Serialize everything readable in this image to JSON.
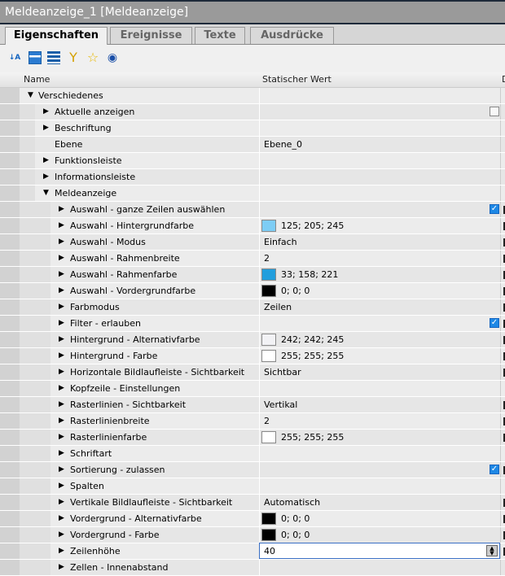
{
  "title": "Meldeanzeige_1 [Meldeanzeige]",
  "tabs": [
    "Eigenschaften",
    "Ereignisse",
    "Texte",
    "Ausdrücke"
  ],
  "header": {
    "name": "Name",
    "value": "Statischer Wert",
    "extra": "D"
  },
  "rows": [
    {
      "label": "Verschiedenes",
      "level": 0,
      "arrow": "down"
    },
    {
      "label": "Aktuelle anzeigen",
      "level": 1,
      "arrow": "right",
      "checkbox": false
    },
    {
      "label": "Beschriftung",
      "level": 1,
      "arrow": "right"
    },
    {
      "label": "Ebene",
      "level": 1,
      "arrow": "none",
      "value": "Ebene_0"
    },
    {
      "label": "Funktionsleiste",
      "level": 1,
      "arrow": "right"
    },
    {
      "label": "Informationsleiste",
      "level": 1,
      "arrow": "right"
    },
    {
      "label": "Meldeanzeige",
      "level": 1,
      "arrow": "down"
    },
    {
      "label": "Auswahl - ganze Zeilen auswählen",
      "level": 2,
      "arrow": "right",
      "checkbox": true,
      "mark": true
    },
    {
      "label": "Auswahl - Hintergrundfarbe",
      "level": 2,
      "arrow": "right",
      "color": "#7dcdf5",
      "value": "125; 205; 245",
      "mark": true
    },
    {
      "label": "Auswahl - Modus",
      "level": 2,
      "arrow": "right",
      "value": "Einfach",
      "mark": true
    },
    {
      "label": "Auswahl - Rahmenbreite",
      "level": 2,
      "arrow": "right",
      "value": "2",
      "mark": true
    },
    {
      "label": "Auswahl - Rahmenfarbe",
      "level": 2,
      "arrow": "right",
      "color": "#219edd",
      "value": "33; 158; 221",
      "mark": true
    },
    {
      "label": "Auswahl - Vordergrundfarbe",
      "level": 2,
      "arrow": "right",
      "color": "#000000",
      "value": "0; 0; 0",
      "mark": true
    },
    {
      "label": "Farbmodus",
      "level": 2,
      "arrow": "right",
      "value": "Zeilen",
      "mark": true
    },
    {
      "label": "Filter - erlauben",
      "level": 2,
      "arrow": "right",
      "checkbox": true,
      "mark": true
    },
    {
      "label": "Hintergrund - Alternativfarbe",
      "level": 2,
      "arrow": "right",
      "color": "#f2f2f5",
      "value": "242; 242; 245",
      "mark": true
    },
    {
      "label": "Hintergrund - Farbe",
      "level": 2,
      "arrow": "right",
      "color": "#ffffff",
      "value": "255; 255; 255",
      "mark": true
    },
    {
      "label": "Horizontale Bildlaufleiste - Sichtbarkeit",
      "level": 2,
      "arrow": "right",
      "value": "Sichtbar",
      "mark": true
    },
    {
      "label": "Kopfzeile - Einstellungen",
      "level": 2,
      "arrow": "right"
    },
    {
      "label": "Rasterlinien - Sichtbarkeit",
      "level": 2,
      "arrow": "right",
      "value": "Vertikal",
      "mark": true
    },
    {
      "label": "Rasterlinienbreite",
      "level": 2,
      "arrow": "right",
      "value": "2",
      "mark": true
    },
    {
      "label": "Rasterlinienfarbe",
      "level": 2,
      "arrow": "right",
      "color": "#ffffff",
      "value": "255; 255; 255",
      "mark": true
    },
    {
      "label": "Schriftart",
      "level": 2,
      "arrow": "right"
    },
    {
      "label": "Sortierung - zulassen",
      "level": 2,
      "arrow": "right",
      "checkbox": true,
      "mark": true
    },
    {
      "label": "Spalten",
      "level": 2,
      "arrow": "right"
    },
    {
      "label": "Vertikale Bildlaufleiste - Sichtbarkeit",
      "level": 2,
      "arrow": "right",
      "value": "Automatisch",
      "mark": true
    },
    {
      "label": "Vordergrund - Alternativfarbe",
      "level": 2,
      "arrow": "right",
      "color": "#000000",
      "value": "0; 0; 0",
      "mark": true
    },
    {
      "label": "Vordergrund - Farbe",
      "level": 2,
      "arrow": "right",
      "color": "#000000",
      "value": "0; 0; 0",
      "mark": true
    },
    {
      "label": "Zeilenhöhe",
      "level": 2,
      "arrow": "right",
      "value": "40",
      "editing": true,
      "mark": true
    },
    {
      "label": "Zellen - Innenabstand",
      "level": 2,
      "arrow": "right"
    }
  ]
}
